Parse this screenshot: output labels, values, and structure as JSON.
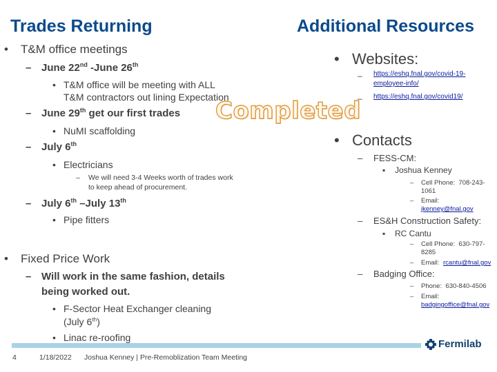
{
  "left": {
    "title": "Trades Returning",
    "bullet1": {
      "label": "T&M office meetings",
      "items": [
        {
          "label_pre": "June 22",
          "sup1": "nd",
          "label_mid": " -June 26",
          "sup2": "th",
          "sub": [
            "T&M office will be meeting with ALL",
            "T&M contractors out lining Expectation"
          ]
        },
        {
          "label_pre": "June 29",
          "sup1": "th",
          "label_post": " get our first trades",
          "sub": [
            "NuMI scaffolding"
          ]
        },
        {
          "label_pre": "July 6",
          "sup1": "th",
          "sub": [
            "Electricians"
          ],
          "subsub": [
            "We will need 3-4 Weeks worth of trades work",
            "to keep ahead of procurement."
          ]
        },
        {
          "label_pre": "July 6",
          "sup1": "th",
          "label_mid": " –July 13",
          "sup2": "th",
          "sub": [
            "Pipe fitters"
          ]
        }
      ]
    },
    "bullet2": {
      "label": "Fixed Price Work",
      "item": [
        "Will work in the same fashion, details",
        "being worked out."
      ],
      "sub1_line1": "F-Sector Heat Exchanger cleaning",
      "sub1_line2_pre": "(July 6",
      "sub1_line2_sup": "th",
      "sub1_line2_post": ")",
      "sub2": "Linac re-roofing"
    },
    "stamp": "Completed"
  },
  "right": {
    "title": "Additional Resources",
    "websites": {
      "label": "Websites:",
      "links": [
        [
          "https://eshq.fnal.gov/covid-19-",
          "employee-info/"
        ],
        [
          "https://eshq.fnal.gov/covid19/"
        ]
      ]
    },
    "contacts": {
      "label": "Contacts",
      "groups": [
        {
          "label": "FESS-CM:",
          "person": "Joshua Kenney",
          "phone_label": "Cell Phone:",
          "phone": [
            "708-243-",
            "1061"
          ],
          "email_label": "Email:",
          "email": "jkenney@fnal.gov"
        },
        {
          "label": "ES&H Construction Safety:",
          "person": "RC Cantu",
          "phone_label": "Cell Phone:",
          "phone": [
            "630-797-",
            "8285"
          ],
          "email_label": "Email:",
          "email": "rcantu@fnal.gov"
        },
        {
          "label": "Badging Office:",
          "phone_label": "Phone:",
          "phone": [
            "630-840-4506"
          ],
          "email_label": "Email:",
          "email": "badgingoffice@fnal.gov"
        }
      ]
    }
  },
  "footer": {
    "page_number": "4",
    "date": "1/18/2022",
    "text": "Joshua Kenney | Pre-Remoblization Team Meeting",
    "logo": "Fermilab",
    "bar_color": "#a7d3e6",
    "brand_color": "#0b4a8b"
  }
}
